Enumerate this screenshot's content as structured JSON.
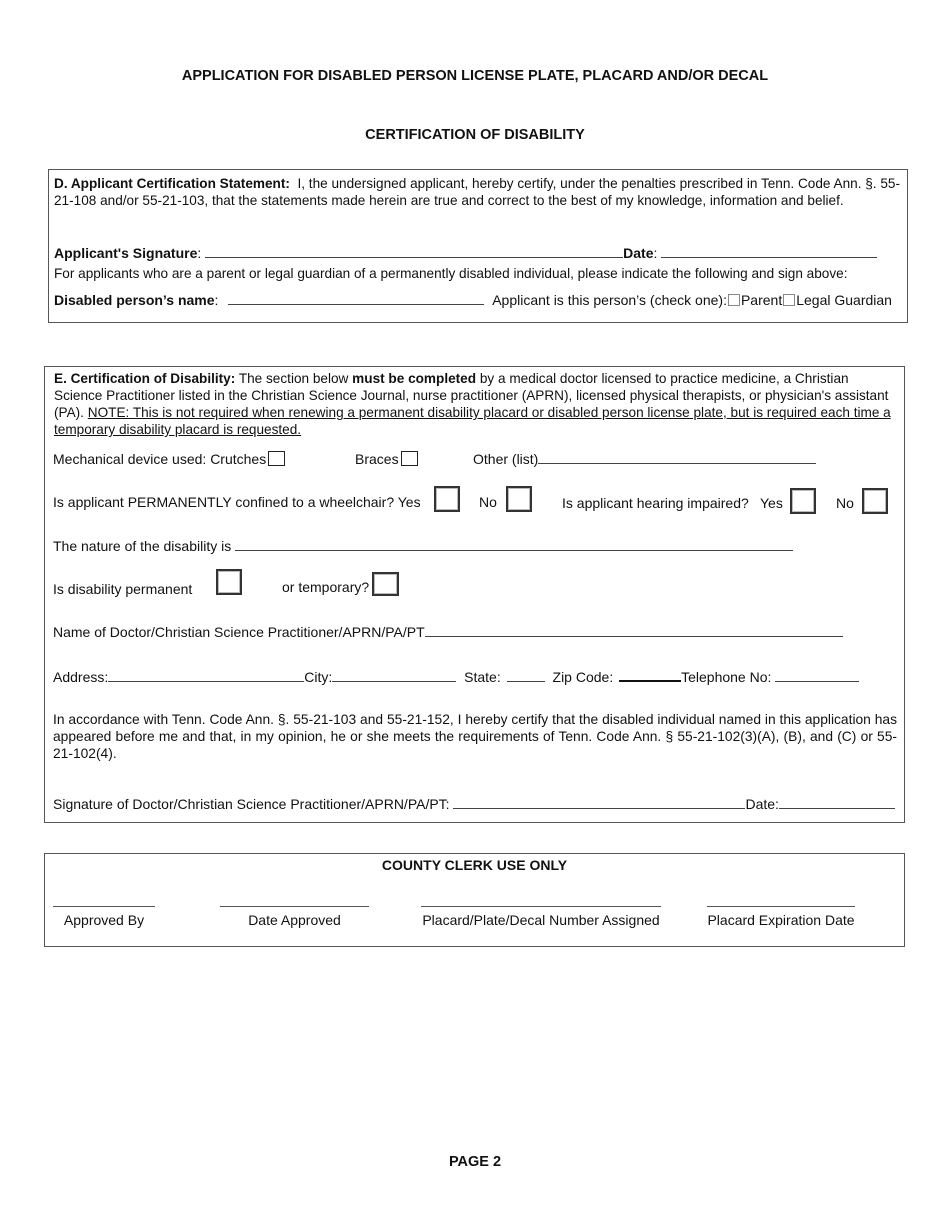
{
  "header": {
    "title": "APPLICATION FOR DISABLED PERSON LICENSE PLATE, PLACARD AND/OR DECAL",
    "subtitle": "CERTIFICATION OF DISABILITY"
  },
  "section_d": {
    "heading": "D. Applicant Certification Statement:",
    "statement": "I, the undersigned applicant, hereby certify, under the penalties prescribed in Tenn. Code Ann. §. 55-21-108 and/or 55-21-103, that the statements made herein are true and correct to the best of my knowledge, information and belief.",
    "signature_label": "Applicant's Signature",
    "date_label": "Date",
    "guardian_instruction": "For applicants who are a parent or legal guardian of a permanently disabled individual, please indicate the following and sign above:",
    "disabled_name_label": "Disabled person’s name",
    "relationship_prompt": "Applicant is this person’s (check one):",
    "options": [
      "Parent",
      "Legal Guardian"
    ]
  },
  "section_e": {
    "heading": "E. Certification of Disability:",
    "intro_part1": "The section below",
    "intro_bold": "must be completed",
    "intro_part2": "by a medical doctor licensed to practice medicine, a Christian Science Practitioner listed in the Christian Science Journal, nurse practitioner (APRN),  licensed physical therapists, or physician's assistant (PA).",
    "note": "NOTE: This is not required when renewing a permanent disability placard or disabled person license plate, but is required each time a temporary disability placard is requested.",
    "mechanical_label": "Mechanical device used: Crutches",
    "braces_label": "Braces",
    "other_label": "Other (list)",
    "wheelchair_question": "Is applicant PERMANENTLY confined to a wheelchair? Yes",
    "no_label": "No",
    "hearing_question": "Is applicant hearing impaired?",
    "yes_label": "Yes",
    "nature_label": "The nature of the disability is",
    "permanent_label": "Is disability permanent",
    "temporary_label": "or temporary?",
    "doctor_name_label": "Name of Doctor/Christian Science Practitioner/APRN/PA/PT",
    "address_label": "Address:",
    "city_label": "City:",
    "state_label": "State:",
    "zip_label": "Zip Code:",
    "telephone_label": "Telephone No:",
    "certification_text": "In accordance with Tenn. Code Ann. §. 55-21-103 and 55-21-152, I hereby certify that the disabled individual named in this application has appeared before me and that, in my opinion, he or she meets the requirements of Tenn. Code Ann. § 55-21-102(3)(A), (B), and (C) or 55- 21-102(4).",
    "doctor_signature_label": "Signature of Doctor/Christian Science Practitioner/APRN/PA/PT:",
    "date_label": "Date:"
  },
  "county_clerk": {
    "heading": "COUNTY CLERK USE ONLY",
    "fields": [
      "Approved By",
      "Date Approved",
      "Placard/Plate/Decal Number Assigned",
      "Placard Expiration Date"
    ]
  },
  "footer": {
    "page_label": "PAGE 2"
  }
}
